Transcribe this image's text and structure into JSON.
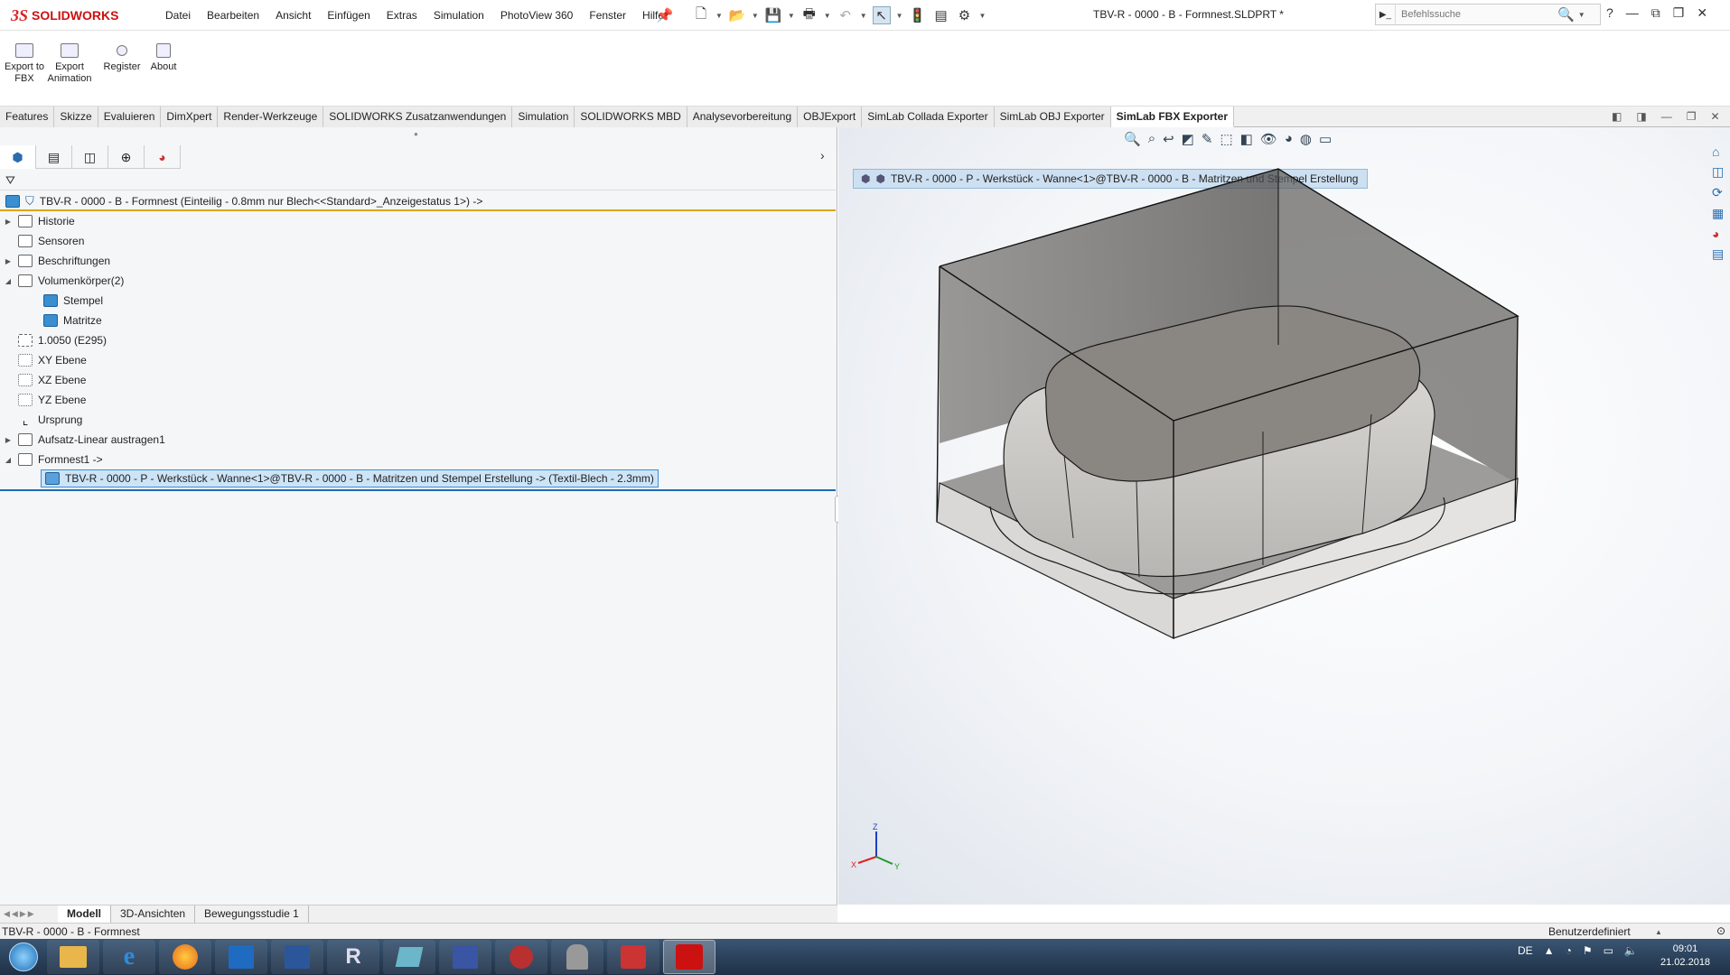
{
  "app": {
    "logo_ds": "3S",
    "logo_name": "SOLIDWORKS",
    "menus": [
      "Datei",
      "Bearbeiten",
      "Ansicht",
      "Einfügen",
      "Extras",
      "Simulation",
      "PhotoView 360",
      "Fenster",
      "Hilfe"
    ],
    "document_title": "TBV-R - 0000 - B - Formnest.SLDPRT *",
    "search_placeholder": "Befehlssuche",
    "help_label": "?"
  },
  "ribbon": {
    "buttons": [
      {
        "label": "Export to FBX"
      },
      {
        "label": "Export Animation"
      },
      {
        "label": "Register"
      },
      {
        "label": "About"
      }
    ]
  },
  "tabs": {
    "items": [
      "Features",
      "Skizze",
      "Evaluieren",
      "DimXpert",
      "Render-Werkzeuge",
      "SOLIDWORKS Zusatzanwendungen",
      "Simulation",
      "SOLIDWORKS MBD",
      "Analysevorbereitung",
      "OBJExport",
      "SimLab Collada Exporter",
      "SimLab OBJ Exporter",
      "SimLab FBX Exporter"
    ],
    "active": "SimLab FBX Exporter"
  },
  "tree": {
    "root": "TBV-R - 0000 - B - Formnest  (Einteilig - 0.8mm nur Blech<<Standard>_Anzeigestatus 1>) ->",
    "nodes": [
      {
        "label": "Historie",
        "expander": "▶",
        "icon": "history-icon"
      },
      {
        "label": "Sensoren",
        "expander": "",
        "icon": "sensor-icon"
      },
      {
        "label": "Beschriftungen",
        "expander": "▶",
        "icon": "annotation-icon"
      },
      {
        "label": "Volumenkörper(2)",
        "expander": "◢",
        "icon": "solid-bodies-icon"
      },
      {
        "label": "Stempel",
        "expander": "",
        "icon": "solid-body-icon"
      },
      {
        "label": "Matritze",
        "expander": "",
        "icon": "solid-body-icon"
      },
      {
        "label": "1.0050 (E295)",
        "expander": "",
        "icon": "material-icon"
      },
      {
        "label": "XY Ebene",
        "expander": "",
        "icon": "plane-icon"
      },
      {
        "label": "XZ Ebene",
        "expander": "",
        "icon": "plane-icon"
      },
      {
        "label": "YZ Ebene",
        "expander": "",
        "icon": "plane-icon"
      },
      {
        "label": "Ursprung",
        "expander": "",
        "icon": "origin-icon"
      },
      {
        "label": "Aufsatz-Linear austragen1",
        "expander": "▶",
        "icon": "extrude-icon"
      },
      {
        "label": "Formnest1 ->",
        "expander": "◢",
        "icon": "cavity-icon"
      }
    ],
    "selected": "TBV-R - 0000 - P - Werkstück - Wanne<1>@TBV-R - 0000 - B - Matritzen und Stempel Erstellung -> (Textil-Blech - 2.3mm)"
  },
  "viewport": {
    "breadcrumb": "TBV-R - 0000 - P - Werkstück - Wanne<1>@TBV-R - 0000 - B - Matritzen und Stempel Erstellung",
    "triad": {
      "x": "X",
      "y": "Y",
      "z": "Z"
    }
  },
  "bottom_tabs": [
    "Modell",
    "3D-Ansichten",
    "Bewegungsstudie 1"
  ],
  "status": {
    "left": "TBV-R - 0000 - B - Formnest",
    "right": "Benutzerdefiniert"
  },
  "taskbar": {
    "apps": [
      {
        "icon": "explorer-icon",
        "color": "#e8b64a"
      },
      {
        "icon": "internet-explorer-icon",
        "color": "#2a8de0"
      },
      {
        "icon": "firefox-icon",
        "color": "#e66a1f"
      },
      {
        "icon": "outlook-icon",
        "color": "#1f6bc2"
      },
      {
        "icon": "word-icon",
        "color": "#2b579a"
      },
      {
        "icon": "jr-icon",
        "color": "#555c66"
      },
      {
        "icon": "notes-icon",
        "color": "#6bb6c8"
      },
      {
        "icon": "visio-icon",
        "color": "#3955a3"
      },
      {
        "icon": "app-64-icon",
        "color": "#b83030"
      },
      {
        "icon": "user-app-icon",
        "color": "#999999"
      },
      {
        "icon": "solidworks-alt-icon",
        "color": "#c33"
      },
      {
        "icon": "solidworks-2016-icon",
        "color": "#c11"
      }
    ],
    "language": "DE",
    "time": "09:01",
    "date": "21.02.2018"
  },
  "colors": {
    "accent_blue": "#3b8ed8",
    "tree_bg": "#f4f6f8",
    "root_underline": "#d9a800",
    "taskbar": "#2a4360"
  }
}
